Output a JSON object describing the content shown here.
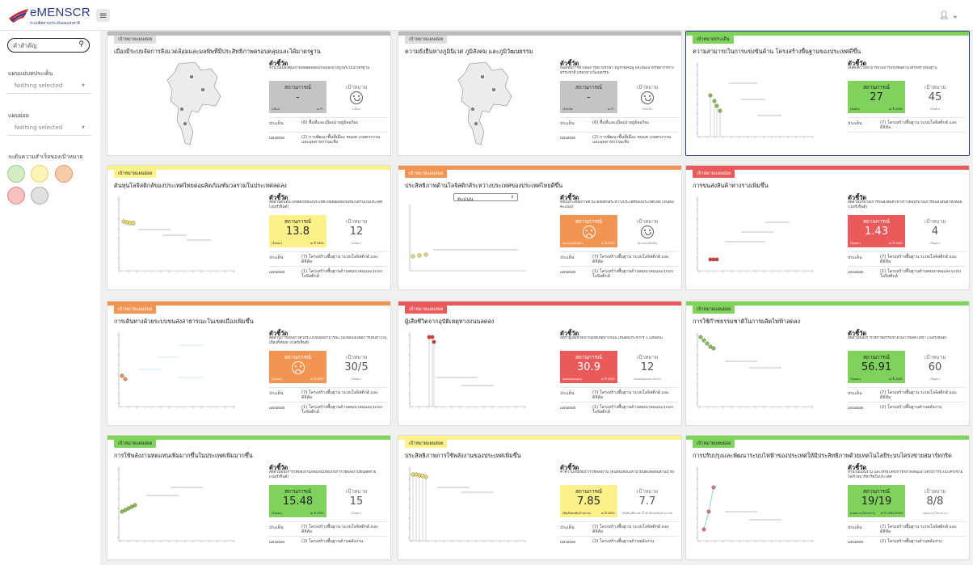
{
  "app": {
    "logo_text": "eMENSCR",
    "logo_sub": "ระบบติดตามประเมินผลแห่งชาติ"
  },
  "sidebar": {
    "search_placeholder": "คำสำคัญ",
    "filter1_label": "แผนแม่บทประเด็น",
    "filter1_value": "Nothing selected",
    "filter2_label": "แผนย่อย",
    "filter2_value": "Nothing selected",
    "status_label": "ระดับความสำเร็จของเป้าหมาย",
    "status_colors": [
      "#d3ecc4",
      "#fbf3b8",
      "#f6caa8",
      "#f5c1c1",
      "#e0e0e0"
    ]
  },
  "cards": [
    {
      "tag": "เป้าหมายแผนย่อย",
      "title": "เมืองมีระบบจัดการสิ่งแวดล้อมและมลพิษที่มีประสิทธิภาพครอบคลุมและได้มาตรฐาน",
      "viz": "map",
      "kpi_label": "ตัวชี้วัด",
      "kpi_desc": "จำนวนเมืองคุณภาพที่สอดคล้องกับเมืองน่าอยู่ในระบบมาตรฐาน",
      "status_head": "สถานการณ์",
      "status_value": "-",
      "status_unit": "(เมือง)",
      "status_year": "ณ ปี -",
      "target_head": "เป้าหมาย",
      "target_value": "",
      "target_unit": "(เมือง)",
      "face": "happy",
      "k1": "ประเด็น",
      "v1": "(6) พื้นที่และเมืองน่าอยู่อัจฉริยะ",
      "k2": "แผนย่อย",
      "v2": "(2) การพัฒนาพื้นที่เมือง ชนบท เกษตรกรรมและอุตสาหกรรมเชิง"
    },
    {
      "tag": "เป้าหมายแผนย่อย",
      "title": "ความยั่งยืนทางภูมินิเวศ ภูมิสังคม และภูมิวัฒนธรรม",
      "viz": "map",
      "kpi_label": "ตัวชี้วัด",
      "kpi_desc": "พื้นที่ที่มีการดำเนินการสงวนรักษา อนุรักษ์ฟื้นฟู และพัฒนาทรัพยากรทางธรรมชาติ มรดกทางวัฒนธรรม",
      "status_head": "สถานการณ์",
      "status_value": "-",
      "status_unit": "(จังหวัด)",
      "status_year": "ณ ปี -",
      "target_head": "เป้าหมาย",
      "target_value": "",
      "target_unit": "(จังหวัด)",
      "face": "happy",
      "k1": "ประเด็น",
      "v1": "(6) พื้นที่และเมืองน่าอยู่อัจฉริยะ",
      "k2": "แผนย่อย",
      "v2": "(2) การพัฒนาพื้นที่เมือง ชนบท เกษตรกรรมและอุตสาหกรรมเชิง"
    },
    {
      "tag": "เป้าหมายประเด็น",
      "title": "ความสามารถในการแข่งขันด้าน โครงสร้างพื้นฐานของประเทศดีขึ้น",
      "viz": "chart",
      "kpi_label": "ตัวชี้วัด",
      "kpi_desc": "อันดับความสามารถในการแข่งขันด้านโครงสร้างพื้นฐาน",
      "status_head": "สถานการณ์",
      "status_value": "27",
      "status_unit": "(อันดับ)",
      "status_year": "ณ ปี 2562",
      "target_head": "เป้าหมาย",
      "target_value": "45",
      "target_unit": "(อันดับ)",
      "face": "",
      "k1": "ประเด็น",
      "v1": "(7) โครงสร้างพื้นฐาน ระบบโลจิสติกส์ และดิจิทัล",
      "k2": "",
      "v2": ""
    },
    {
      "tag": "เป้าหมายแผนย่อย",
      "title": "ต้นทุนโลจิสติกส์ของประเทศไทยต่อผลิตภัณฑ์มวลรวมในประเทศลดลง",
      "viz": "chart",
      "kpi_label": "ตัวชี้วัด",
      "kpi_desc": "สัดส่วนต้นทุนโลจิสติกส์ของประเทศไทยต่อผลิตภัณฑ์มวลรวมในประเทศ (เปอร์เซ็นต์)",
      "status_head": "สถานการณ์",
      "status_value": "13.8",
      "status_unit": "(ร้อยละ)",
      "status_year": "ณ ปี 2561",
      "target_head": "เป้าหมาย",
      "target_value": "12",
      "target_unit": "(ร้อยละ)",
      "face": "",
      "k1": "ประเด็น",
      "v1": "(7) โครงสร้างพื้นฐาน ระบบโลจิสติกส์ และดิจิทัล",
      "k2": "แผนย่อย",
      "v2": "(1) โครงสร้างพื้นฐานด้านคมนาคมและระบบโลจิสติกส์"
    },
    {
      "tag": "เป้าหมายแผนย่อย",
      "title": "ประสิทธิภาพด้านโลจิสติกส์ระหว่างประเทศของประเทศไทยดีขึ้น",
      "viz": "chart",
      "dropdown": "คะแนน",
      "kpi_label": "ตัวชี้วัด",
      "kpi_desc": "ดัชนีประสิทธิภาพด้านโลจิสติกส์ระหว่างประเทศของประเทศไทย (อันดับ/คะแนน)",
      "status_head": "สถานการณ์",
      "status_value": "",
      "status_unit": "(คะแนน/อันดับ)",
      "status_year": "ณ ปี 2561",
      "target_head": "เป้าหมาย",
      "target_value": "",
      "target_unit": "(คะแนน/อันดับ)",
      "face": "sad",
      "k1": "ประเด็น",
      "v1": "(7) โครงสร้างพื้นฐาน ระบบโลจิสติกส์ และดิจิทัล",
      "k2": "แผนย่อย",
      "v2": "(1) โครงสร้างพื้นฐานด้านคมนาคมและระบบโลจิสติกส์"
    },
    {
      "tag": "เป้าหมายแผนย่อย",
      "title": "การขนส่งสินค้าทางรางเพิ่มขึ้น",
      "viz": "chart",
      "kpi_label": "ตัวชี้วัด",
      "kpi_desc": "สัดส่วนปริมาณการขนส่งสินค้าทางรางต่อปริมาณการขนส่งสินค้าทั้งหมด (เปอร์เซ็นต์)",
      "status_head": "สถานการณ์",
      "status_value": "1.43",
      "status_unit": "(ร้อยละ)",
      "status_year": "ณ ปี 2561",
      "target_head": "เป้าหมาย",
      "target_value": "4",
      "target_unit": "(ร้อยละ)",
      "face": "",
      "k1": "ประเด็น",
      "v1": "(7) โครงสร้างพื้นฐาน ระบบโลจิสติกส์ และดิจิทัล",
      "k2": "แผนย่อย",
      "v2": "(1) โครงสร้างพื้นฐานด้านคมนาคมและระบบโลจิสติกส์"
    },
    {
      "tag": "เป้าหมายแผนย่อย",
      "title": "การเดินทางด้วยระบบขนส่งสาธารณะในเขตเมืองเพิ่มขึ้น",
      "viz": "chart",
      "kpi_label": "ตัวชี้วัด",
      "kpi_desc": "สัดส่วนการเดินทางด้วยระบบขนส่งสาธารณะในเขตเมืองต่อการเดินทางในเมืองทั้งหมด (เปอร์เซ็นต์)",
      "status_head": "สถานการณ์",
      "status_value": "",
      "status_unit": "(ร้อยละ)",
      "status_year": "ณ ปี 2561",
      "target_head": "เป้าหมาย",
      "target_value": "30/5",
      "target_unit": "(ร้อยละ)",
      "face": "sad",
      "k1": "ประเด็น",
      "v1": "(7) โครงสร้างพื้นฐาน ระบบโลจิสติกส์ และดิจิทัล",
      "k2": "แผนย่อย",
      "v2": "(1) โครงสร้างพื้นฐานด้านคมนาคมและระบบโลจิสติกส์"
    },
    {
      "tag": "เป้าหมายแผนย่อย",
      "title": "ผู้เสียชีวิตจากอุบัติเหตุทางถนนลดลง",
      "viz": "chart",
      "kpi_label": "ตัวชี้วัด",
      "kpi_desc": "อัตราผู้เสียชีวิตจากอุบัติเหตุทางถนน (คนต่อประชากร 1 แสนคน)",
      "status_head": "สถานการณ์",
      "status_value": "30.9",
      "status_unit": "(คนต่อแสนคน)",
      "status_year": "ณ ปี 2561",
      "target_head": "เป้าหมาย",
      "target_value": "12",
      "target_unit": "(คนต่อแสนประชากร)",
      "face": "",
      "k1": "ประเด็น",
      "v1": "(7) โครงสร้างพื้นฐาน ระบบโลจิสติกส์ และดิจิทัล",
      "k2": "แผนย่อย",
      "v2": "(1) โครงสร้างพื้นฐานด้านคมนาคมและระบบโลจิสติกส์"
    },
    {
      "tag": "เป้าหมายแผนย่อย",
      "title": "การใช้ก๊าซธรรมชาติในการผลิตไฟฟ้าลดลง",
      "viz": "chart",
      "kpi_label": "ตัวชี้วัด",
      "kpi_desc": "สัดส่วนของการใช้ก๊าซธรรมชาติในการผลิตไฟฟ้า (เปอร์เซ็นต์)",
      "status_head": "สถานการณ์",
      "status_value": "56.91",
      "status_unit": "(ร้อยละ)",
      "status_year": "ณ ปี 2561",
      "target_head": "เป้าหมาย",
      "target_value": "60",
      "target_unit": "(ร้อยละ)",
      "face": "",
      "k1": "ประเด็น",
      "v1": "(7) โครงสร้างพื้นฐาน ระบบโลจิสติกส์ และดิจิทัล",
      "k2": "แผนย่อย",
      "v2": "(2) โครงสร้างพื้นฐานด้านพลังงาน"
    },
    {
      "tag": "เป้าหมายแผนย่อย",
      "title": "การใช้พลังงานทดแทนเพิ่มมากขึ้นในประเทศเพิ่มมากขึ้น",
      "viz": "chart",
      "kpi_label": "ตัวชี้วัด",
      "kpi_desc": "สัดส่วนของการใช้พลังงานทดแทนเทียบกับการใช้พลังงานขั้นสุดท้าย (เปอร์เซ็นต์)",
      "status_head": "สถานการณ์",
      "status_value": "15.48",
      "status_unit": "(ร้อยละ)",
      "status_year": "ณ ปี 2561",
      "target_head": "เป้าหมาย",
      "target_value": "15",
      "target_unit": "(ร้อยละ)",
      "face": "",
      "k1": "ประเด็น",
      "v1": "(7) โครงสร้างพื้นฐาน ระบบโลจิสติกส์ และดิจิทัล",
      "k2": "แผนย่อย",
      "v2": "(2) โครงสร้างพื้นฐานด้านพลังงาน"
    },
    {
      "tag": "เป้าหมายแผนย่อย",
      "title": "ประสิทธิภาพการใช้พลังงานของประเทศเพิ่มขึ้น",
      "viz": "chart",
      "kpi_label": "ตัวชี้วัด",
      "kpi_desc": "ค่าความเข้มข้นการใช้พลังงาน (พันตันเทียบเท่าน้ำมันดิบต่อพันล้านบาท)",
      "status_head": "สถานการณ์",
      "status_value": "7.85",
      "status_unit": "(พันตันต่อพันล้านบาท)",
      "status_year": "ณ ปี 2561",
      "target_head": "เป้าหมาย",
      "target_value": "7.7",
      "target_unit": "(พันตันเทียบเท่าน้ำมันดิบต่อพันล้านบาท)",
      "face": "",
      "k1": "ประเด็น",
      "v1": "(7) โครงสร้างพื้นฐาน ระบบโลจิสติกส์ และดิจิทัล",
      "k2": "แผนย่อย",
      "v2": "(2) โครงสร้างพื้นฐานด้านพลังงาน"
    },
    {
      "tag": "เป้าหมายแผนย่อย",
      "title": "การปรับปรุงและพัฒนาระบบไฟฟ้าของประเทศให้มีประสิทธิภาพด้วยเทคโนโลยีระบบโครงข่ายสมาร์ทกริด",
      "viz": "chart",
      "kpi_label": "ตัวชี้วัด",
      "kpi_desc": "จำนวนแผนงาน และ/หรือโครงการที่กำลังพัฒนาโครงการระบบโครงข่ายไฟฟ้าสมาร์ทกริดในประเทศ",
      "status_head": "สถานการณ์",
      "status_value": "19/19",
      "status_unit": "(แผนงาน/โครงการ)",
      "status_year": "ณ ปี 2562/2563",
      "target_head": "เป้าหมาย",
      "target_value": "8/8",
      "target_unit": "(แผนงาน/โครงการ)",
      "face": "",
      "k1": "ประเด็น",
      "v1": "(7) โครงสร้างพื้นฐาน ระบบโลจิสติกส์ และดิจิทัล",
      "k2": "แผนย่อย",
      "v2": "(2) โครงสร้างพื้นฐานด้านพลังงาน"
    }
  ]
}
